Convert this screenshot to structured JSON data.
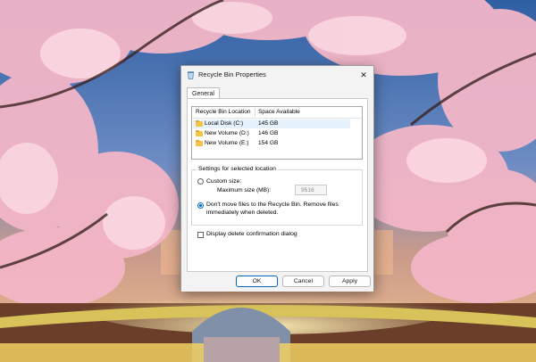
{
  "dialog": {
    "title": "Recycle Bin Properties",
    "close_glyph": "✕",
    "tab_label": "General",
    "columns": [
      "Recycle Bin Location",
      "Space Available"
    ],
    "drives": [
      {
        "name": "Local Disk (C:)",
        "space": "145 GB",
        "selected": true
      },
      {
        "name": "New Volume (D:)",
        "space": "146 GB",
        "selected": false
      },
      {
        "name": "New Volume (E:)",
        "space": "154 GB",
        "selected": false
      }
    ],
    "settings_label": "Settings for selected location",
    "custom_size_label": "Custom size:",
    "max_size_label": "Maximum size (MB):",
    "max_size_value": "9516",
    "dont_move_label_line1": "Don't move files to the Recycle Bin. Remove files",
    "dont_move_label_line2": "immediately when deleted.",
    "confirm_label": "Display delete confirmation dialog",
    "buttons": {
      "ok": "OK",
      "cancel": "Cancel",
      "apply": "Apply"
    }
  },
  "icons": {
    "title": "recycle-bin-icon",
    "folder": "drive-folder-icon"
  },
  "colors": {
    "accent": "#0067c0",
    "selection": "#e5f1fb",
    "dialog_bg": "#f3f3f3"
  }
}
